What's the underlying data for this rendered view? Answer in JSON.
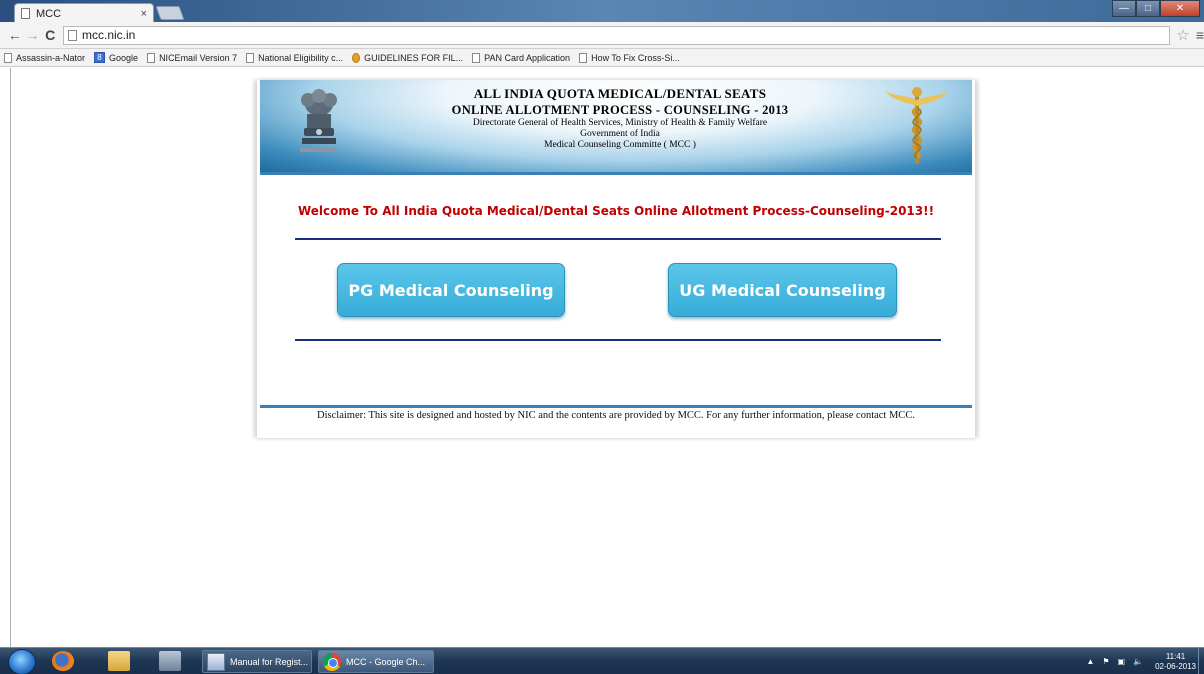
{
  "browser": {
    "tab_title": "MCC",
    "tab_close": "×",
    "address": "mcc.nic.in",
    "bookmarks": [
      {
        "label": "Assassin-a-Nator",
        "icon": "page-icon"
      },
      {
        "label": "Google",
        "icon": "google-icon"
      },
      {
        "label": "NICEmail Version 7",
        "icon": "page-icon"
      },
      {
        "label": "National Eligibility c...",
        "icon": "page-icon"
      },
      {
        "label": "GUIDELINES FOR FIL...",
        "icon": "guidelines-icon"
      },
      {
        "label": "PAN Card Application",
        "icon": "page-icon"
      },
      {
        "label": "How To Fix Cross-Si...",
        "icon": "page-icon"
      }
    ]
  },
  "header": {
    "line1": "ALL INDIA QUOTA MEDICAL/DENTAL SEATS",
    "line2": "ONLINE ALLOTMENT PROCESS - COUNSELING - 2013",
    "line3": "Directorate General of Health Services, Ministry of Health & Family Welfare",
    "line4": "Government of India",
    "line5": "Medical Counseling Committe ( MCC )"
  },
  "main": {
    "welcome": "Welcome To All India Quota Medical/Dental Seats Online Allotment Process-Counseling-2013!!",
    "pg_button": "PG Medical Counseling",
    "ug_button": "UG Medical Counseling"
  },
  "footer": {
    "disclaimer": "Disclaimer: This site is designed and hosted by NIC and the contents are provided by MCC. For any further information, please contact MCC."
  },
  "taskbar": {
    "tasks": [
      "Manual for Regist...",
      "MCC - Google Ch..."
    ],
    "time": "11:41",
    "date": "02-06-2013"
  },
  "colors": {
    "welcome": "#c00000",
    "button": "#3fb3df",
    "rule": "#1a2f80",
    "header_band": "#3a7fb5"
  }
}
